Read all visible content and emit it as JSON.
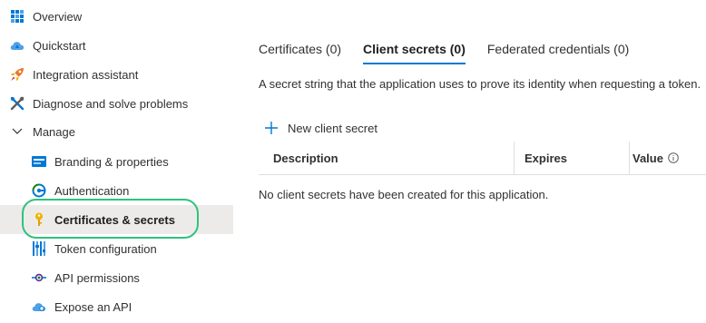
{
  "sidebar": {
    "items": [
      {
        "label": "Overview",
        "icon": "overview-grid-icon"
      },
      {
        "label": "Quickstart",
        "icon": "cloud-quickstart-icon"
      },
      {
        "label": "Integration assistant",
        "icon": "rocket-icon"
      },
      {
        "label": "Diagnose and solve problems",
        "icon": "wrench-icon"
      },
      {
        "label": "Manage",
        "icon": "chevron-down-icon",
        "expanded": true
      },
      {
        "label": "Branding & properties",
        "icon": "branding-card-icon"
      },
      {
        "label": "Authentication",
        "icon": "authentication-icon"
      },
      {
        "label": "Certificates & secrets",
        "icon": "key-icon",
        "selected": true
      },
      {
        "label": "Token configuration",
        "icon": "token-bars-icon"
      },
      {
        "label": "API permissions",
        "icon": "api-permissions-icon"
      },
      {
        "label": "Expose an API",
        "icon": "cloud-api-icon"
      }
    ]
  },
  "main": {
    "tabs": [
      {
        "label": "Certificates (0)",
        "active": false
      },
      {
        "label": "Client secrets (0)",
        "active": true
      },
      {
        "label": "Federated credentials (0)",
        "active": false
      }
    ],
    "description": "A secret string that the application uses to prove its identity when requesting a token.",
    "new_button_label": "New client secret",
    "table": {
      "columns": [
        "Description",
        "Expires",
        "Value"
      ],
      "empty_message": "No client secrets have been created for this application."
    }
  },
  "colors": {
    "accent": "#0078d4",
    "highlight_ring": "#2ec27e",
    "selected_bg": "#edebe9",
    "key": "#f2b400"
  }
}
